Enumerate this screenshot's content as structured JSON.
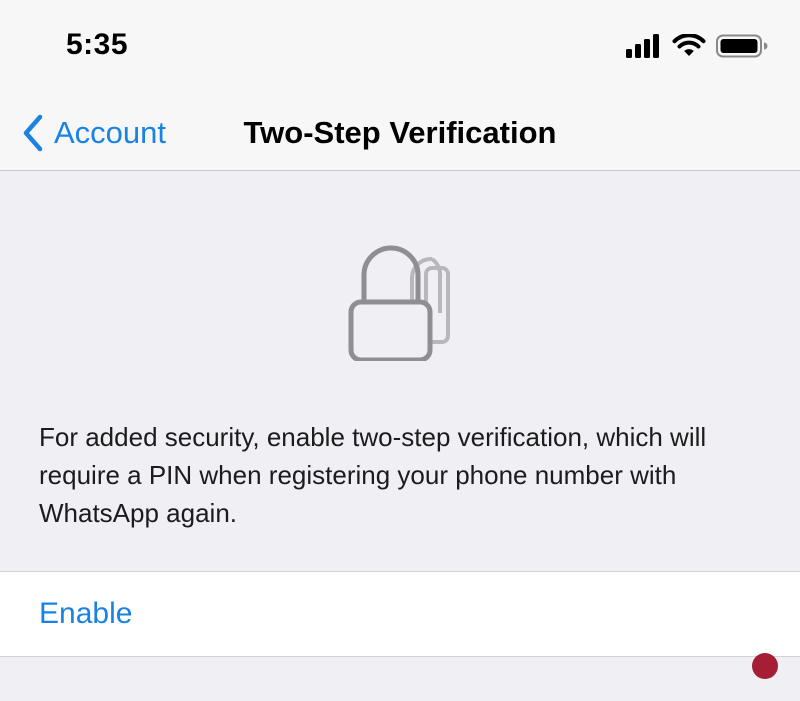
{
  "status_bar": {
    "time": "5:35"
  },
  "nav": {
    "back_label": "Account",
    "title": "Two-Step Verification"
  },
  "main": {
    "description": "For added security, enable two-step verification, which will require a PIN when registering your phone number with WhatsApp again.",
    "enable_label": "Enable"
  },
  "icons": [
    "signal-icon",
    "wifi-icon",
    "battery-icon",
    "chevron-left-icon",
    "lock-icon",
    "watermark-logo"
  ],
  "colors": {
    "accent": "#1a82e2",
    "background": "#efeff4",
    "bar_background": "#f7f7f7",
    "lock_gray": "#8e8e93"
  }
}
